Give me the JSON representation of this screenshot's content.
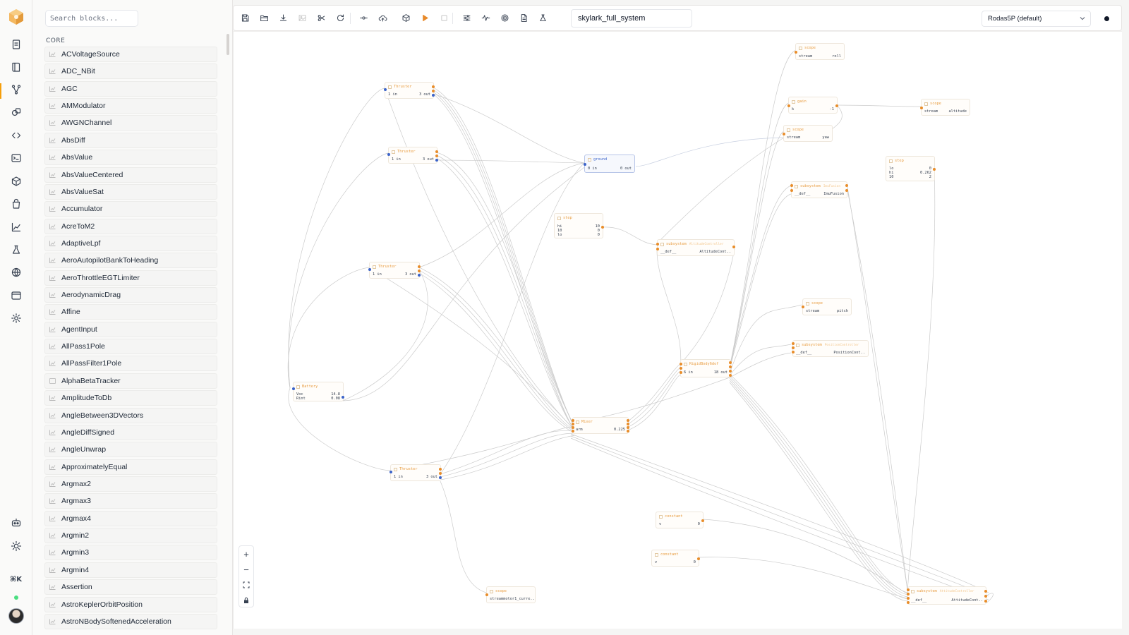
{
  "app": {
    "model_name": "skylark_full_system",
    "solver": "Rodas5P (default)"
  },
  "library": {
    "search_placeholder": "Search blocks...",
    "section": "CORE",
    "blocks": [
      "ACVoltageSource",
      "ADC_NBit",
      "AGC",
      "AMModulator",
      "AWGNChannel",
      "AbsDiff",
      "AbsValue",
      "AbsValueCentered",
      "AbsValueSat",
      "Accumulator",
      "AcreToM2",
      "AdaptiveLpf",
      "AeroAutopilotBankToHeading",
      "AeroThrottleEGTLimiter",
      "AerodynamicDrag",
      "Affine",
      "AgentInput",
      "AllPass1Pole",
      "AllPassFilter1Pole",
      "AlphaBetaTracker",
      "AmplitudeToDb",
      "AngleBetween3DVectors",
      "AngleDiffSigned",
      "AngleUnwrap",
      "ApproximatelyEqual",
      "Argmax2",
      "Argmax3",
      "Argmax4",
      "Argmin2",
      "Argmin3",
      "Argmin4",
      "Assertion",
      "AstroKeplerOrbitPosition",
      "AstroNBodySoftenedAcceleration"
    ]
  },
  "rail_icons": [
    "document-icon",
    "book-icon",
    "graph-icon",
    "shapes-icon",
    "code-icon",
    "terminal-icon",
    "cube-icon",
    "bag-icon",
    "chart-icon",
    "flask-icon",
    "globe-icon",
    "window-icon",
    "settings-icon",
    "robot-icon",
    "sun-icon"
  ],
  "rail_shortcut": "⌘K",
  "toolbar_icons": [
    "save-icon",
    "open-folder-icon",
    "download-icon",
    "image-icon",
    "scissors-icon",
    "refresh-icon",
    "step-icon",
    "upload-cloud-icon",
    "cube-icon",
    "play-icon",
    "stop-icon",
    "sliders-icon",
    "waveform-icon",
    "target-icon",
    "file-icon",
    "flask-icon"
  ],
  "zoom": {
    "in": "+",
    "out": "−"
  },
  "nodes": {
    "scope_roll": {
      "title": "scope",
      "k1": "stream",
      "v1": "roll"
    },
    "gain": {
      "title": "gain",
      "k1": "k",
      "v1": "-1"
    },
    "scope_altitude": {
      "title": "scope",
      "k1": "stream",
      "v1": "altitude"
    },
    "scope_yaw": {
      "title": "scope",
      "k1": "stream",
      "v1": "yaw"
    },
    "thruster1": {
      "title": "Thruster",
      "k1": "1 in",
      "v1": "3 out"
    },
    "thruster2": {
      "title": "Thruster",
      "k1": "1 in",
      "v1": "3 out"
    },
    "ground": {
      "title": "ground",
      "k1": "0 in",
      "v1": "0 out"
    },
    "step_right": {
      "title": "step",
      "k1": "lo",
      "v1": "0",
      "k2": "hi",
      "v2": "0.262",
      "k3": "10",
      "v3": "2"
    },
    "imu_subsystem": {
      "title": "subsystem",
      "sub": "ImuFusion",
      "k1": "__def__",
      "v1": "ImuFusion"
    },
    "step_left": {
      "title": "step",
      "k1": "hi",
      "v1": "10",
      "k2": "10",
      "v2": "0",
      "k3": "lo",
      "v3": "0"
    },
    "alt_subsystem": {
      "title": "subsystem",
      "sub": "AltitudeController",
      "k1": "__def__",
      "v1": "AltitudeCont.."
    },
    "thruster3": {
      "title": "Thruster",
      "k1": "1 in",
      "v1": "3 out"
    },
    "scope_pitch": {
      "title": "scope",
      "k1": "stream",
      "v1": "pitch"
    },
    "pos_subsystem": {
      "title": "subsystem",
      "sub": "PositionController",
      "k1": "__def__",
      "v1": "PositionCont.."
    },
    "rigid_body": {
      "title": "RigidBody6dof",
      "k1": "6 in",
      "v1": "18 out"
    },
    "battery": {
      "title": "Battery",
      "k1": "Voc",
      "v1": "14.8",
      "k2": "Rint",
      "v2": "0.08"
    },
    "mixer": {
      "title": "Mixer",
      "k1": "arm",
      "v1": "0.225"
    },
    "thruster4": {
      "title": "Thruster",
      "k1": "1 in",
      "v1": "3 out"
    },
    "constant1": {
      "title": "constant",
      "k1": "v",
      "v1": "0"
    },
    "constant2": {
      "title": "constant",
      "k1": "v",
      "v1": "0"
    },
    "scope_motor": {
      "title": "scope",
      "k1": "stream",
      "v1": "motor1_curre.."
    },
    "att_subsystem": {
      "title": "subsystem",
      "sub": "AttitudeController",
      "k1": "__def__",
      "v1": "AttitudeCont.."
    }
  }
}
